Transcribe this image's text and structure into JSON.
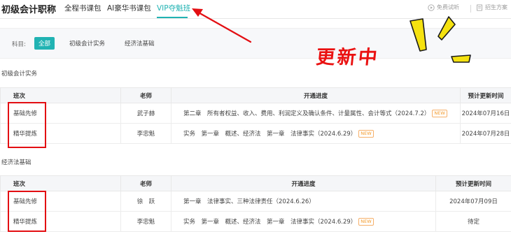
{
  "header": {
    "title": "初级会计职称",
    "tabs": [
      {
        "label": "全程书课包"
      },
      {
        "label": "AI豪华书课包"
      },
      {
        "label": "VIP夺魁班"
      }
    ],
    "free_trial_label": "免费试听",
    "admission_label": "招生方案"
  },
  "subject_filter": {
    "label": "科目:",
    "options": [
      "全部",
      "初级会计实务",
      "经济法基础"
    ]
  },
  "annotation": {
    "updating_text": "更新中",
    "color": "#e30e12"
  },
  "accent_color": "#21b3b3",
  "sections": [
    {
      "title": "初级会计实务",
      "columns": [
        "班次",
        "老师",
        "开通进度",
        "预计更新时间"
      ],
      "rows": [
        {
          "class_name": "基础先修",
          "teacher": "武子赫",
          "progress": "第二章　所有者权益、收入、费用、利润定义及确认条件、计量属性、会计等式（2024.7.2）",
          "badge": "NEW",
          "update_time": "2024年07月16日"
        },
        {
          "class_name": "精华提炼",
          "teacher": "李忠魁",
          "progress": "实务　第一章　概述、经济法　第一章　法律事实（2024.6.29）",
          "badge": "NEW",
          "update_time": "2024年07月28日"
        }
      ]
    },
    {
      "title": "经济法基础",
      "columns": [
        "班次",
        "老师",
        "开通进度",
        "预计更新时间"
      ],
      "rows": [
        {
          "class_name": "基础先修",
          "teacher": "徐　跃",
          "progress": "第一章　法律事实、三种法律责任（2024.6.26）",
          "badge": "",
          "update_time": "2024年07月09日"
        },
        {
          "class_name": "精华提炼",
          "teacher": "李忠魁",
          "progress": "实务　第一章　概述、经济法　第一章　法律事实（2024.6.29）",
          "badge": "NEW",
          "update_time": "待定"
        }
      ]
    }
  ]
}
